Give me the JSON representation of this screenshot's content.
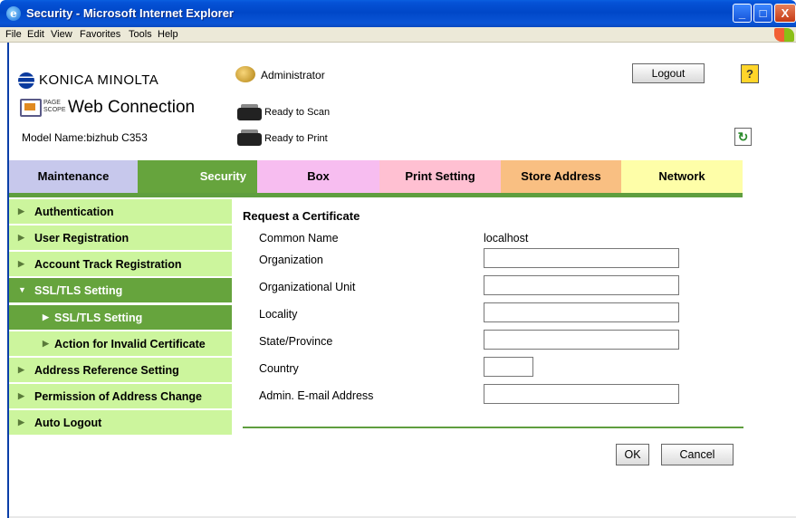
{
  "window": {
    "title": "Security - Microsoft Internet Explorer",
    "controls": {
      "minimize": "_",
      "maximize": "□",
      "close": "X"
    }
  },
  "menubar": {
    "items": [
      {
        "label": "File"
      },
      {
        "label": "Edit"
      },
      {
        "label": "View"
      },
      {
        "label": "Favorites"
      },
      {
        "label": "Tools"
      },
      {
        "label": "Help"
      }
    ]
  },
  "header": {
    "brand": "KONICA MINOLTA",
    "pagescope": "PAGE SCOPE",
    "product": "Web Connection",
    "model_label": "Model Name",
    "model_value": "bizhub C353",
    "user_icon": "admin-user-icon",
    "user": "Administrator",
    "logout": "Logout",
    "help": "?",
    "status_scan": "Ready to Scan",
    "status_print": "Ready to Print",
    "refresh_icon": "refresh-icon"
  },
  "tabs": [
    {
      "label": "Maintenance",
      "color": "#c7c8ec"
    },
    {
      "label": "Security",
      "color": "#66a43d",
      "selected": true
    },
    {
      "label": "Box",
      "color": "#f7bdf0"
    },
    {
      "label": "Print Setting",
      "color": "#ffc0d2"
    },
    {
      "label": "Store Address",
      "color": "#f9bf82"
    },
    {
      "label": "Network",
      "color": "#fefea8"
    }
  ],
  "sidebar": {
    "items": [
      {
        "label": "Authentication"
      },
      {
        "label": "User Registration"
      },
      {
        "label": "Account Track Registration"
      },
      {
        "label": "SSL/TLS Setting",
        "expanded": true
      },
      {
        "label": "SSL/TLS Setting",
        "sub": true,
        "active": true
      },
      {
        "label": "Action for Invalid Certificate",
        "sub": true
      },
      {
        "label": "Address Reference Setting"
      },
      {
        "label": "Permission of Address Change"
      },
      {
        "label": "Auto Logout"
      }
    ]
  },
  "form": {
    "title": "Request a Certificate",
    "fields": [
      {
        "label": "Common Name",
        "value": "localhost"
      },
      {
        "label": "Organization",
        "value": ""
      },
      {
        "label": "Organizational Unit",
        "value": ""
      },
      {
        "label": "Locality",
        "value": ""
      },
      {
        "label": "State/Province",
        "value": ""
      },
      {
        "label": "Country",
        "value": ""
      },
      {
        "label": "Admin. E-mail Address",
        "value": ""
      }
    ],
    "ok": "OK",
    "cancel": "Cancel"
  },
  "colors": {
    "accent_green": "#66a43d",
    "sidebar_green": "#ccf59d",
    "titlebar_blue": "#0047c8"
  }
}
